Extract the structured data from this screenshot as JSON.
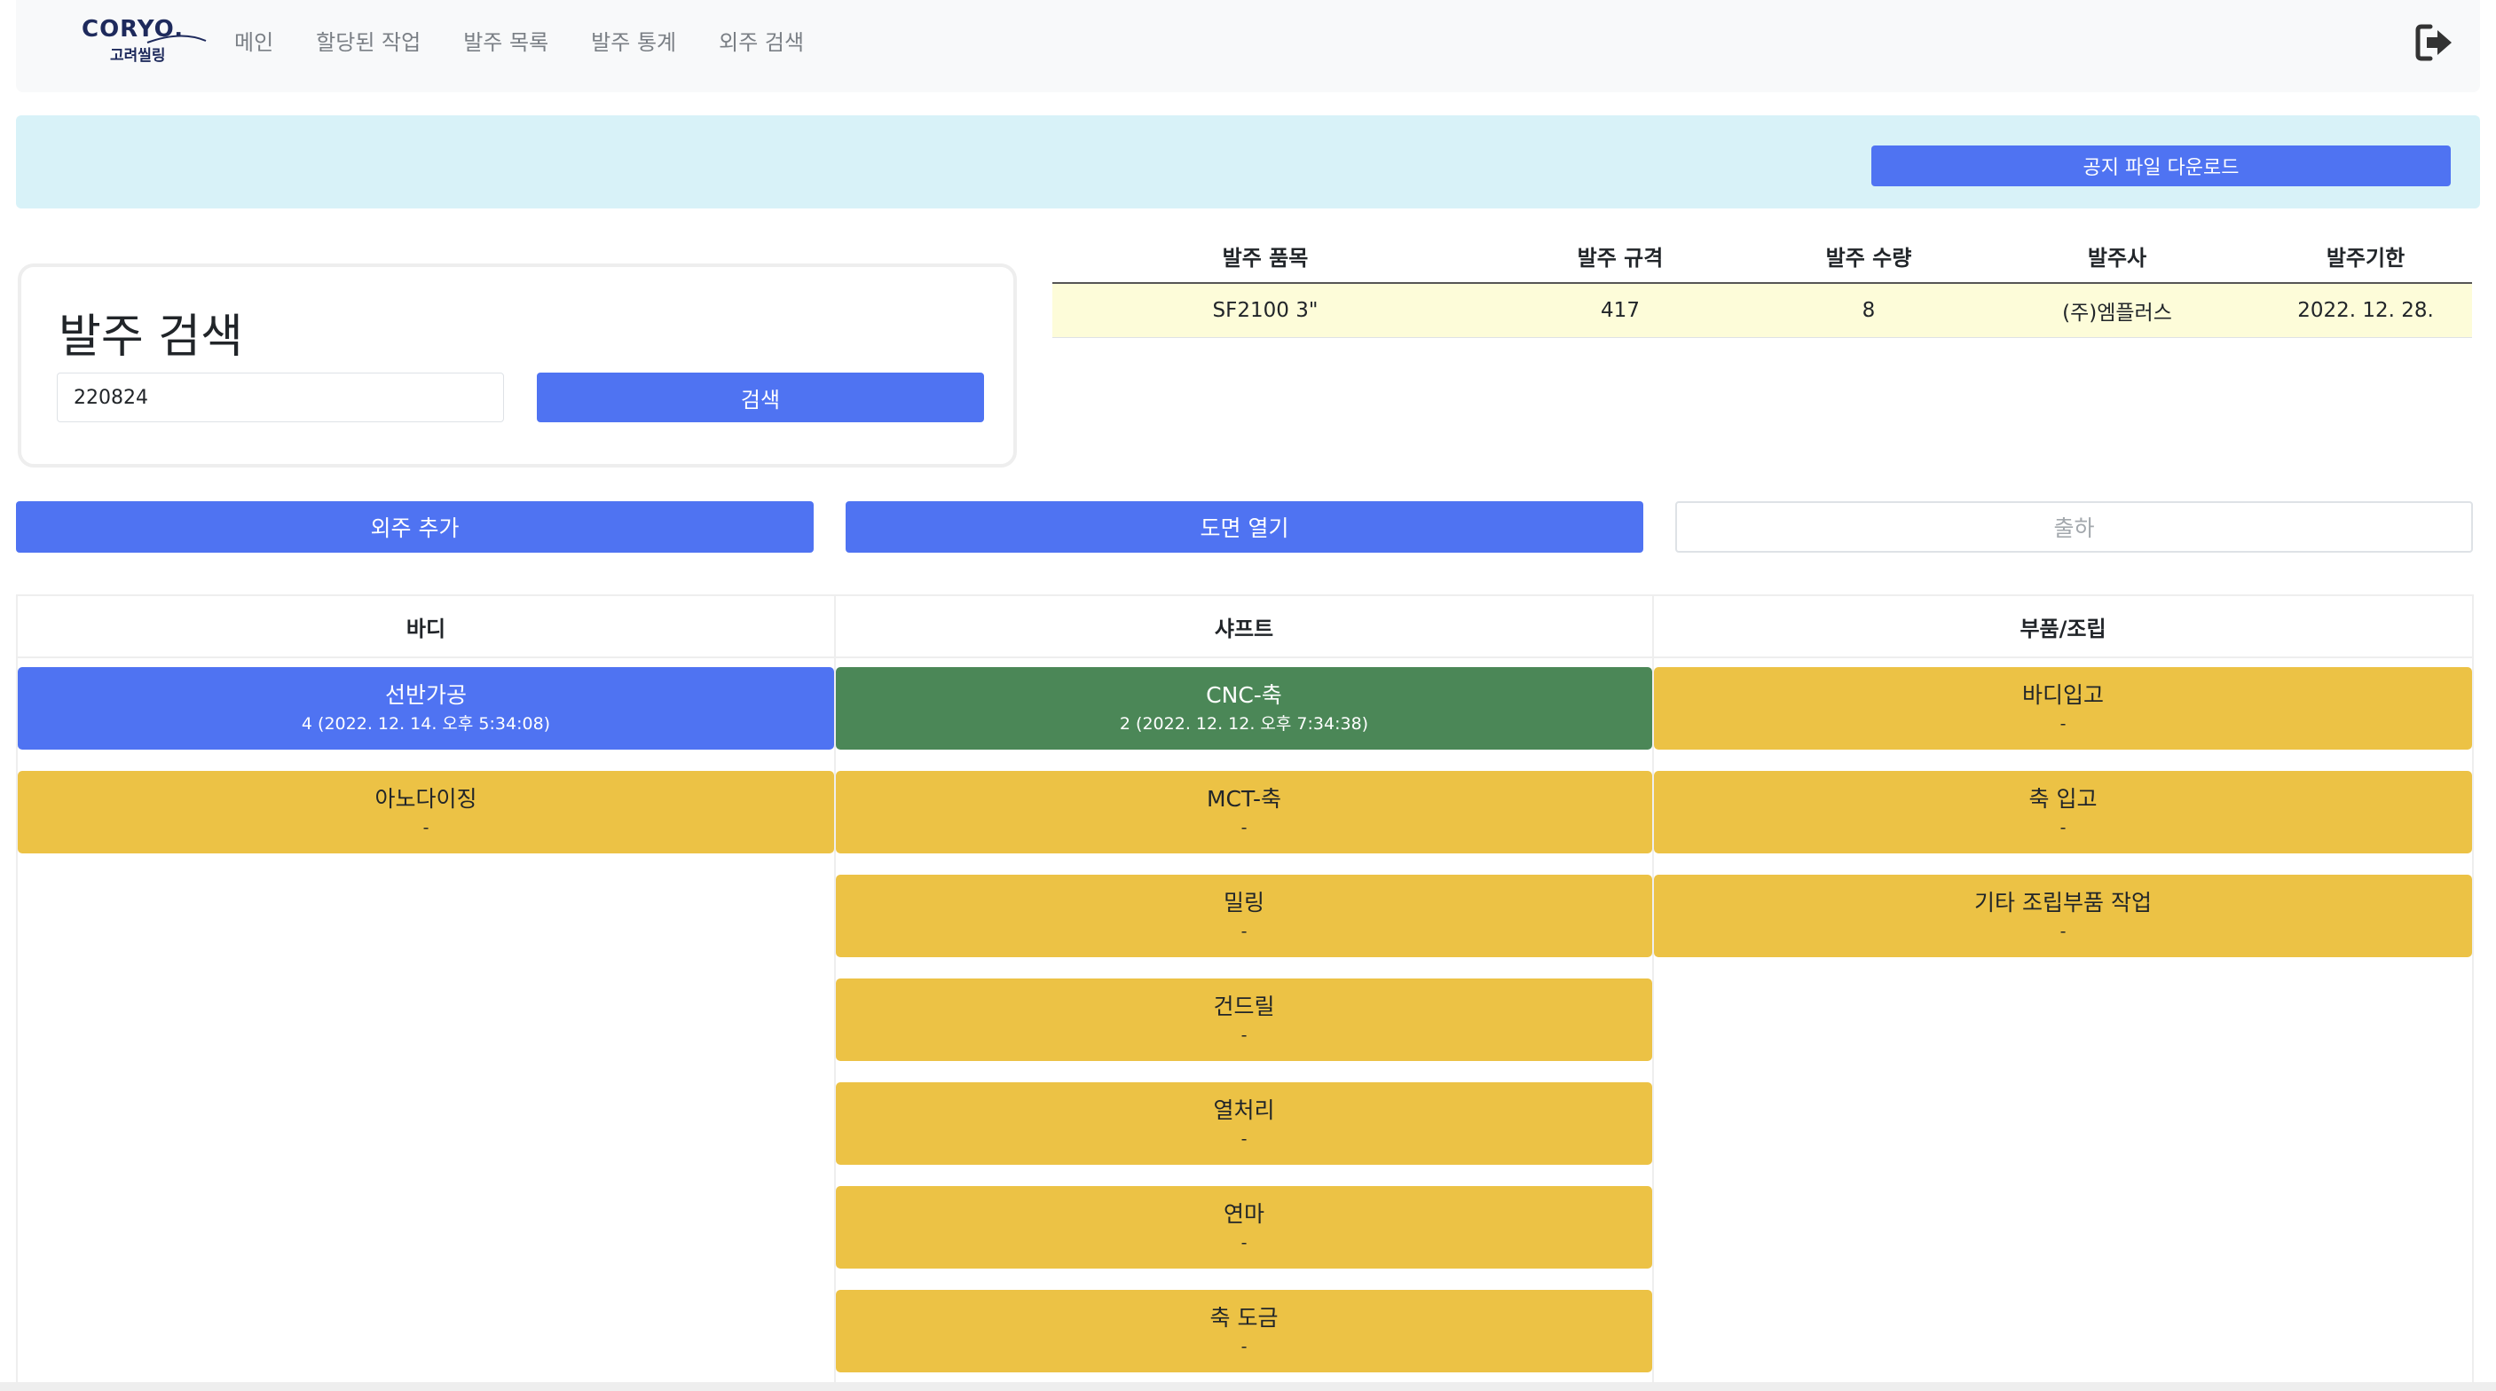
{
  "brand": {
    "logo_main": "CORYO.",
    "logo_sub": "고려씰링"
  },
  "nav": {
    "items": [
      "메인",
      "할당된 작업",
      "발주 목록",
      "발주 통계",
      "외주 검색"
    ]
  },
  "notice": {
    "download_label": "공지 파일 다운로드"
  },
  "search": {
    "title": "발주 검색",
    "input_value": "220824",
    "button_label": "검색"
  },
  "order": {
    "headers": [
      "발주 품목",
      "발주 규격",
      "발주 수량",
      "발주사",
      "발주기한"
    ],
    "row": [
      "SF2100 3\"",
      "417",
      "8",
      "(주)엠플러스",
      "2022. 12. 28."
    ]
  },
  "actions": {
    "add_outsource": "외주 추가",
    "open_drawing": "도면 열기",
    "ship": "출하"
  },
  "columns": [
    {
      "title": "바디",
      "cards": [
        {
          "title": "선반가공",
          "sub": "4 (2022. 12. 14. 오후 5:34:08)",
          "color": "#4f73f2"
        },
        {
          "title": "아노다이징",
          "sub": "-",
          "color": "#ecc245"
        }
      ]
    },
    {
      "title": "샤프트",
      "cards": [
        {
          "title": "CNC-축",
          "sub": "2 (2022. 12. 12. 오후 7:34:38)",
          "color": "#4b8757"
        },
        {
          "title": "MCT-축",
          "sub": "-",
          "color": "#ecc245"
        },
        {
          "title": "밀링",
          "sub": "-",
          "color": "#ecc245"
        },
        {
          "title": "건드릴",
          "sub": "-",
          "color": "#ecc245"
        },
        {
          "title": "열처리",
          "sub": "-",
          "color": "#ecc245"
        },
        {
          "title": "연마",
          "sub": "-",
          "color": "#ecc245"
        },
        {
          "title": "축 도금",
          "sub": "-",
          "color": "#ecc245"
        }
      ]
    },
    {
      "title": "부품/조립",
      "cards": [
        {
          "title": "바디입고",
          "sub": "-",
          "color": "#ecc245"
        },
        {
          "title": "축 입고",
          "sub": "-",
          "color": "#ecc245"
        },
        {
          "title": "기타 조립부품 작업",
          "sub": "-",
          "color": "#ecc245"
        }
      ]
    }
  ],
  "icons": {
    "logout": "logout-icon"
  }
}
